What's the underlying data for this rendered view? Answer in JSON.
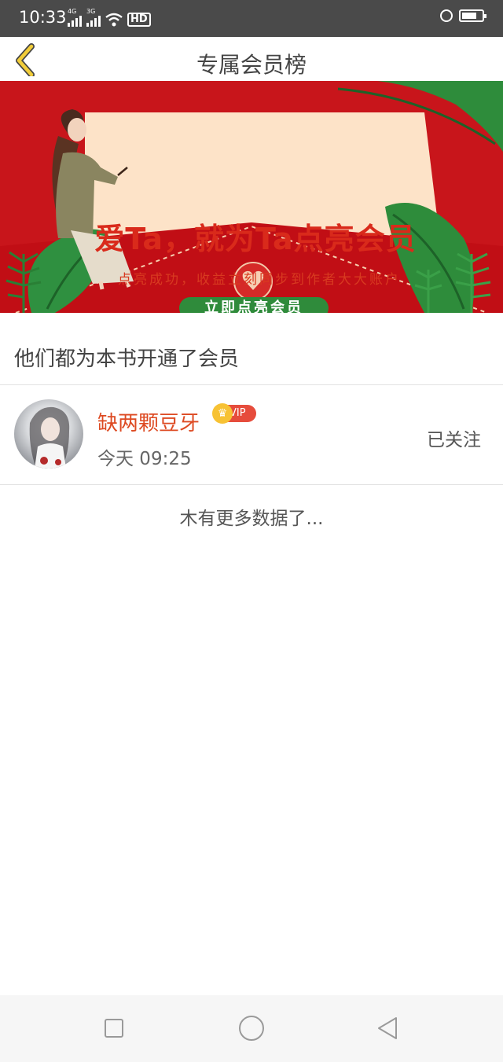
{
  "status_bar": {
    "time": "10:33",
    "network_1": "4G",
    "network_2": "3G",
    "hd_label": "HD",
    "icons": [
      "signal-4g-icon",
      "signal-3g-icon",
      "wifi-icon",
      "hd-icon",
      "lock-icon",
      "battery-icon"
    ]
  },
  "header": {
    "title": "专属会员榜",
    "back_icon": "chevron-left-icon",
    "accent_color": "#f2cd3a"
  },
  "banner": {
    "headline": "爱Ta，就为Ta点亮会员",
    "subline": "点亮成功，收益立刻同步到作者大大账户",
    "button_label": "立即点亮会员",
    "background_color": "#c8151b",
    "button_color": "#2f8b3b"
  },
  "section": {
    "title": "他们都为本书开通了会员"
  },
  "members": [
    {
      "name": "缺两颗豆牙",
      "badge": "VIP",
      "time": "今天 09:25",
      "follow_status": "已关注",
      "name_color": "#dd4a22"
    }
  ],
  "footer": {
    "no_more": "木有更多数据了..."
  },
  "nav_bar": {
    "icons": [
      "recent-apps-icon",
      "home-icon",
      "back-icon"
    ]
  }
}
